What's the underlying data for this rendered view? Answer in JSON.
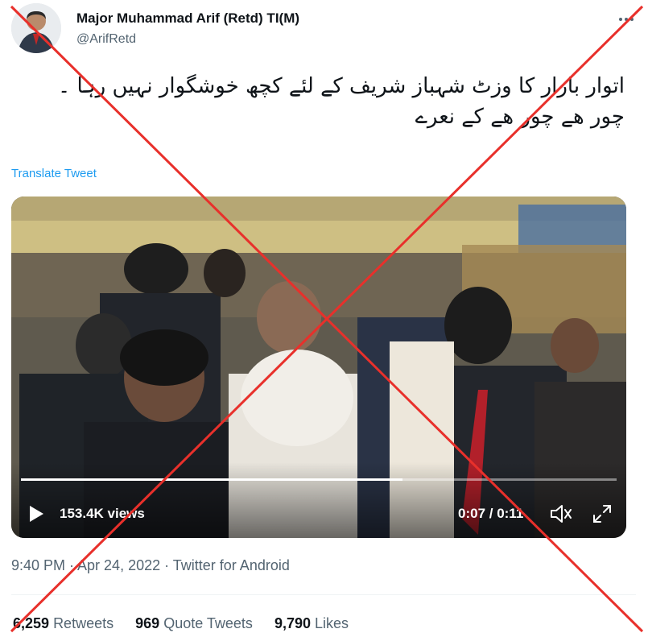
{
  "author": {
    "name": "Major Muhammad Arif (Retd) TI(M)",
    "handle": "@ArifRetd"
  },
  "tweet": {
    "text": "اتوار بازار کا وزٹ شہباز شریف کے لئے کچھ خوشگوار نہیں رہا ۔\nچور ھے چور ھے کے نعرے",
    "translate_label": "Translate Tweet"
  },
  "video": {
    "views": "153.4K views",
    "time": "0:07 / 0:11",
    "progress_fraction": 0.64
  },
  "meta": {
    "timestamp": "9:40 PM · Apr 24, 2022 · Twitter for Android"
  },
  "stats": {
    "retweets_count": "6,259",
    "retweets_label": "Retweets",
    "quotes_count": "969",
    "quotes_label": "Quote Tweets",
    "likes_count": "9,790",
    "likes_label": "Likes"
  },
  "colors": {
    "link": "#1d9bf0",
    "secondary_text": "#536471",
    "overlay_cross": "#e8302b"
  },
  "icons": [
    "avatar",
    "more-icon",
    "play-icon",
    "volume-icon",
    "fullscreen-icon"
  ]
}
